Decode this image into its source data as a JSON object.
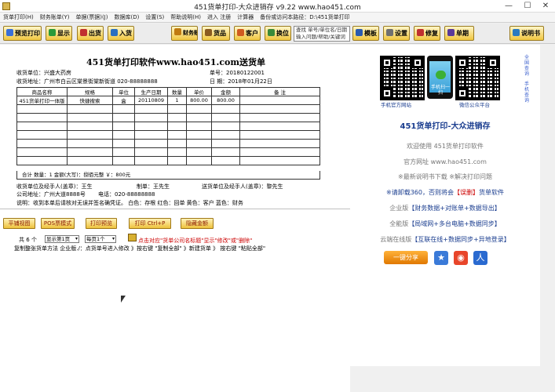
{
  "window": {
    "title": "451货单打印-大众进销存 v9.22    www.hao451.com",
    "minimize": "—",
    "maximize": "☐",
    "close": "✕"
  },
  "menu": {
    "items": [
      "货单打印(H)",
      "财务账单(Y)",
      "单据(票据)(J)",
      "数据库(D)",
      "设置(S)",
      "帮助说明(H)",
      "进入 注册",
      "计算器",
      "备份或访问本路径：D:\\451货单打印"
    ]
  },
  "toolbar": {
    "preview_print": "预览打印",
    "show": "显示",
    "out_stock": "出货",
    "in_stock": "入货",
    "finance": "财务账",
    "goods": "货品",
    "customer": "客户",
    "switch": "换位",
    "search_placeholder_line1": "查找 单号/单位名/日期",
    "search_placeholder_line2": "输入问题/帮助/关键词",
    "template": "模板",
    "settings": "设置",
    "repair": "修复",
    "register": "单期",
    "manual": "说明书"
  },
  "doc": {
    "title": "451货单打印软件www.hao451.com送货单",
    "receiver_unit_label": "收货单位：",
    "receiver_unit": "兴盛大药房",
    "order_no_label": "单号：",
    "order_no": "20180122001",
    "receiver_addr_label": "收货地址：",
    "receiver_addr": "广州市白云区棠景街棠新街道 020-88888888",
    "date_label": "日  期：",
    "date": "2018年01月22日",
    "columns": [
      "商品名称",
      "规格",
      "单位",
      "生产日期",
      "数量",
      "单价",
      "金额",
      "备 注"
    ],
    "rows": [
      [
        "451货单打印一体版",
        "快捷搜索",
        "盒",
        "20110809",
        "1",
        "800.00",
        "800.00",
        ""
      ]
    ],
    "total_line": "合计   数量：1     金额(大写)：捌佰元整       ￥：800元",
    "receiver_sign": "收货单位及经手人(盖章)：王生",
    "maker": "制单：王先生",
    "sender_sign": "送货单位及经手人(盖章)：黎先生",
    "company_addr": "公司地址：广州大道8888号",
    "phone": "电话：020-88888888",
    "note": "说明：收到本单后请核对无误并签名确凭证。   白色：存根     红色：回单     黄色：客户     蓝色：财务"
  },
  "actions": {
    "tile_view": "平铺视图",
    "pos_mode": "POS票模式",
    "print_preview": "打印预览",
    "print": "打印 Ctrl+P",
    "hide_amount": "隐藏金额"
  },
  "pager": {
    "total_prefix": "共",
    "total_count": "6",
    "total_suffix": "个",
    "page_select": "显示第1页",
    "per_page_select": "每页1个"
  },
  "hints": {
    "line1_red": "点击对应\"货单公司名标题\"显示\"修改\"或\"删除\"",
    "line2": "复制整张货单方法 企业版./：点货单号进入修改 》按右键 \"复制全部\" 》新建货单 》 按右键 \"粘贴全部\""
  },
  "right": {
    "qr1_caption": "手机官方网站",
    "qr2_caption": "微信公众平台",
    "phone_caption": "手机扫一扫",
    "vlink1": "全国查询",
    "vlink2": "手机查询",
    "title": "451货单打印-大众进销存",
    "welcome": "欢迎使用 451货单打印软件",
    "site": "官方网址 www.hao451.com",
    "download": "※最新说明书下载 ※解决打印问题",
    "warn_prefix": "※请卸载360，否则将会",
    "warn_red": "【误删】",
    "warn_suffix": "货单软件",
    "enterprise_label": "企业版",
    "enterprise": "【财务数据+对账单+数据导出】",
    "full_label": "全能版",
    "full": "【局域网+多台电脑+数据同步】",
    "cloud_label": "云端在线版",
    "cloud": "【互联在线+数据同步+异地登录】",
    "share_button": "一键分享"
  }
}
